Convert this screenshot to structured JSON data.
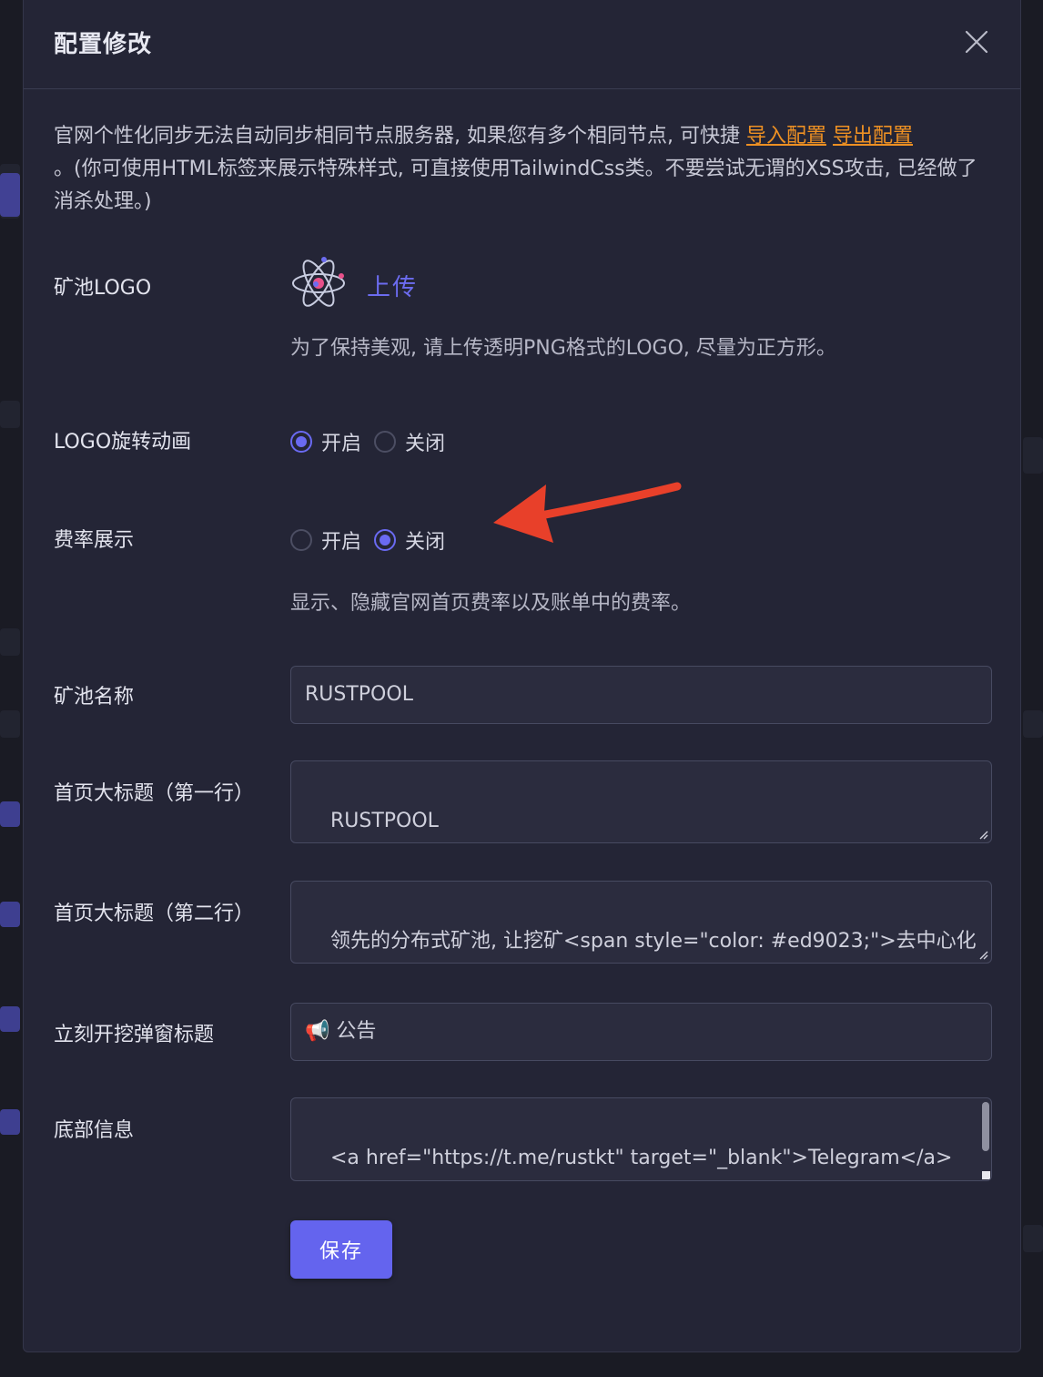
{
  "dialog": {
    "title": "配置修改",
    "notice_text_before": "官网个性化同步无法自动同步相同节点服务器, 如果您有多个相同节点, 可快捷 ",
    "import_link": "导入配置",
    "export_link": "导出配置",
    "notice_text_after": "。(你可使用HTML标签来展示特殊样式, 可直接使用TailwindCss类。不要尝试无谓的XSS攻击, 已经做了消杀处理。)"
  },
  "logo": {
    "label": "矿池LOGO",
    "upload_label": "上传",
    "hint": "为了保持美观, 请上传透明PNG格式的LOGO, 尽量为正方形。"
  },
  "logo_rotation": {
    "label": "LOGO旋转动画",
    "options": [
      "开启",
      "关闭"
    ],
    "selected": "开启"
  },
  "fee_display": {
    "label": "费率展示",
    "options": [
      "开启",
      "关闭"
    ],
    "selected": "关闭",
    "hint": "显示、隐藏官网首页费率以及账单中的费率。"
  },
  "pool_name": {
    "label": "矿池名称",
    "value": "RUSTPOOL"
  },
  "headline_line1": {
    "label": "首页大标题（第一行）",
    "value": "RUSTPOOL"
  },
  "headline_line2": {
    "label": "首页大标题（第二行）",
    "value": "领先的分布式矿池, 让挖矿<span style=\"color: #ed9023;\">去中心化\n</span>"
  },
  "popup_title": {
    "label": "立刻开挖弹窗标题",
    "value": "📢 公告"
  },
  "footer_info": {
    "label": "底部信息",
    "value": "<a href=\"https://t.me/rustkt\" target=\"_blank\">Telegram</a>\n<a href=\"https://github.com/EvilGenius-"
  },
  "save_label": "保存",
  "colors": {
    "accent": "#6464ee",
    "link": "#ed9023",
    "annotation_arrow": "#e8402a",
    "panel": "#242536"
  }
}
